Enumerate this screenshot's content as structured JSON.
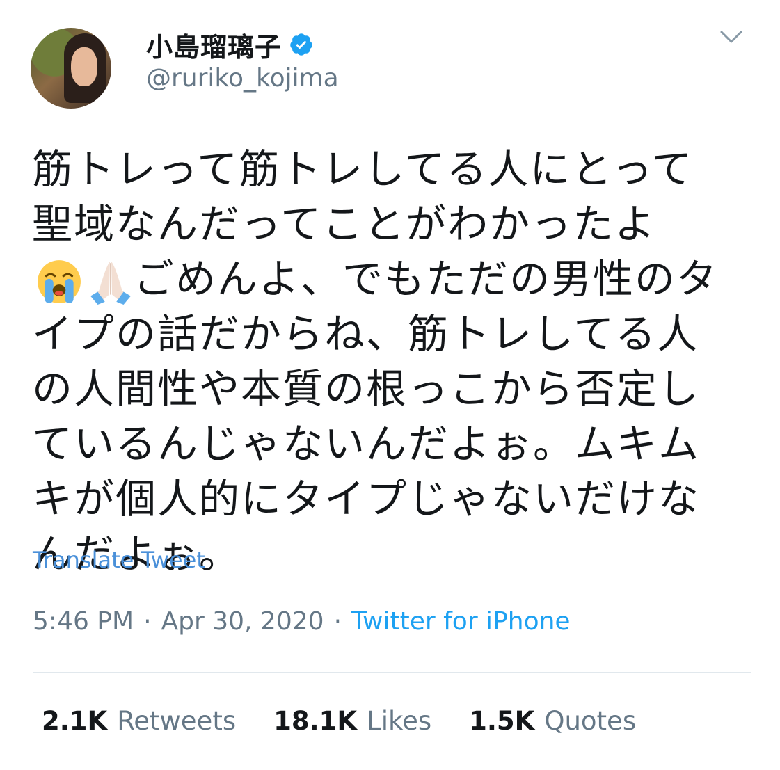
{
  "author": {
    "display_name": "小島瑠璃子",
    "handle": "@ruriko_kojima",
    "verified": true
  },
  "tweet": {
    "text": "筋トレって筋トレしてる人にとって聖域なんだってことがわかったよ",
    "text_after_emoji": "ごめんよ、でもただの男性のタイプの話だからね、筋トレしてる人の人間性や本質の根っこから否定しているんじゃないんだよぉ。ムキムキが個人的にタイプじゃないだけなんだよぉ。",
    "emojis": [
      "loudly-crying-face-icon",
      "folded-hands-icon"
    ],
    "translate_label": "Translate Tweet"
  },
  "meta": {
    "time": "5:46 PM",
    "separator1": "·",
    "date": "Apr 30, 2020",
    "separator2": "·",
    "source": "Twitter for iPhone"
  },
  "stats": {
    "retweets_count": "2.1K",
    "retweets_label": "Retweets",
    "likes_count": "18.1K",
    "likes_label": "Likes",
    "quotes_count": "1.5K",
    "quotes_label": "Quotes"
  },
  "colors": {
    "link": "#1da1f2",
    "secondary_text": "#657786",
    "primary_text": "#14171a"
  }
}
